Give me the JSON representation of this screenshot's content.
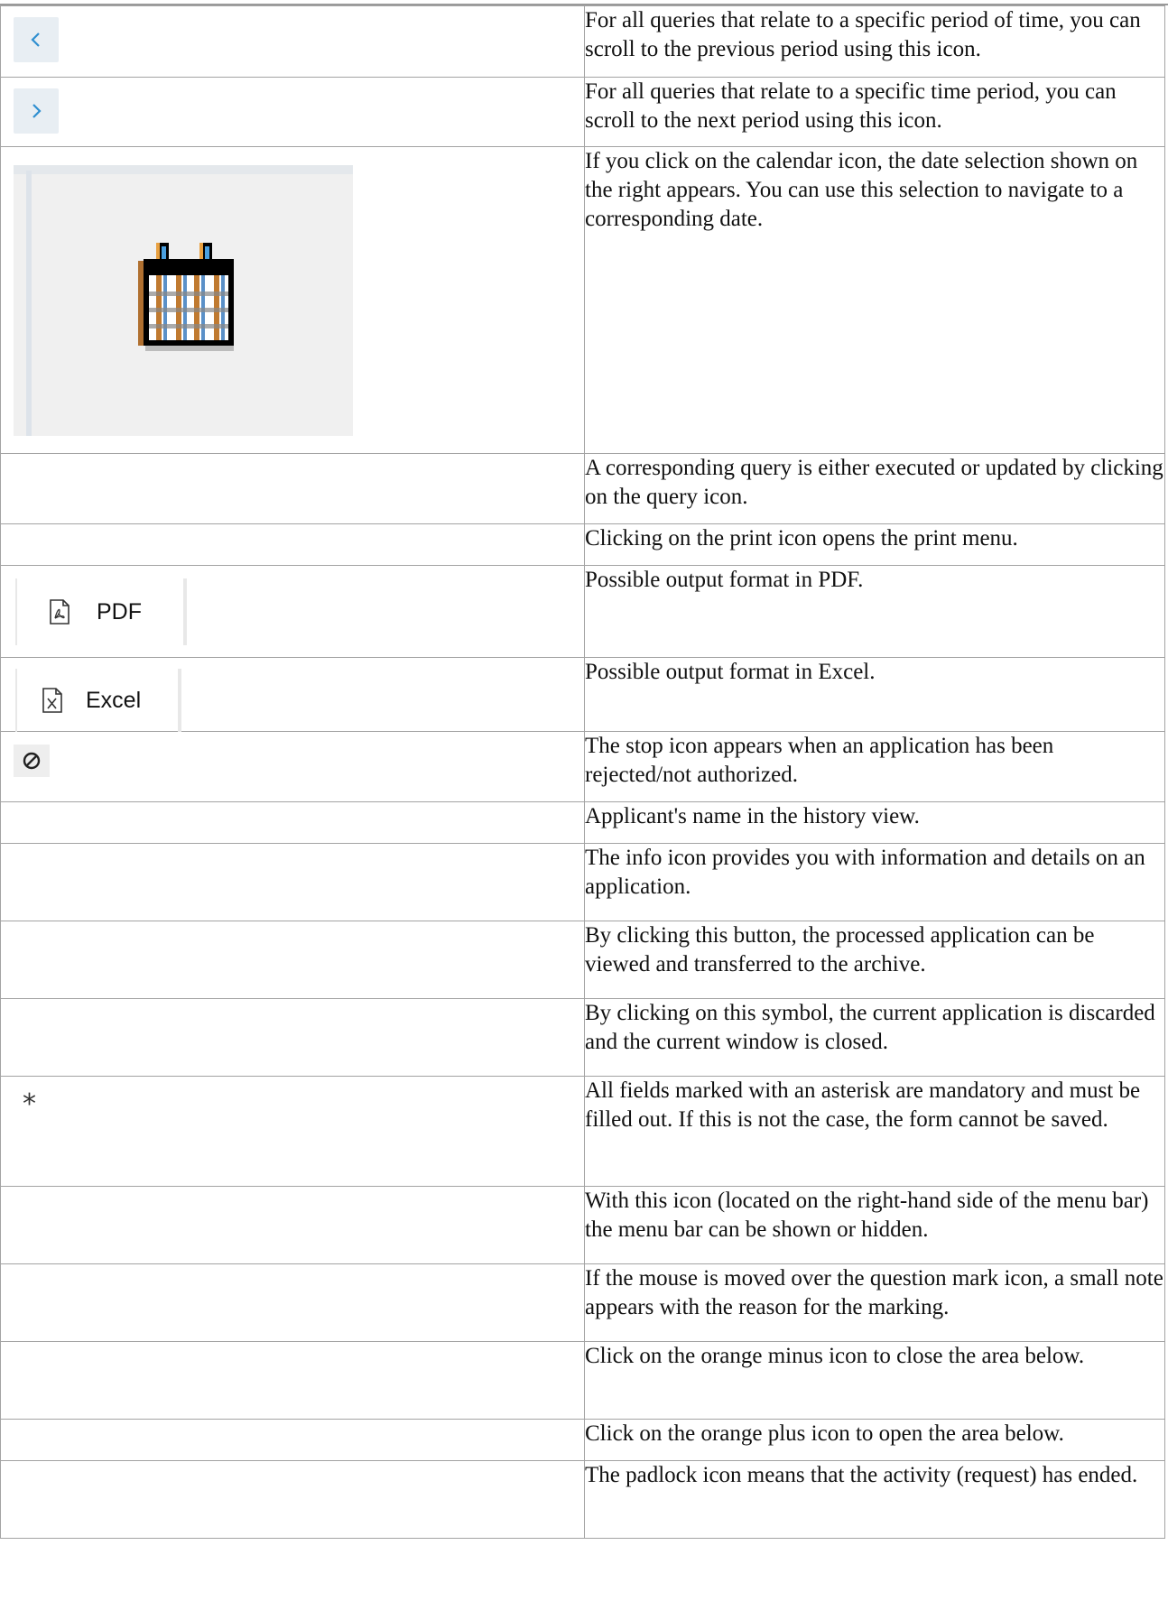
{
  "rows": [
    {
      "icon": "chevron-left-icon",
      "text": "For all queries that relate to a specific period of time, you can scroll to the previous period using this icon."
    },
    {
      "icon": "chevron-right-icon",
      "text": "For all queries that relate to a specific time period, you can scroll to the next period using this icon."
    },
    {
      "icon": "calendar-icon",
      "text": "If you click on the calendar icon, the date selection shown on the right appears. You can use this selection to navigate to a corresponding date."
    },
    {
      "icon": "",
      "text": "A corresponding query is either executed or updated by clicking on the query icon."
    },
    {
      "icon": "",
      "text": "Clicking on the print icon opens the print menu."
    },
    {
      "icon": "pdf-file-icon",
      "button_label": "PDF",
      "text": "Possible output format in PDF."
    },
    {
      "icon": "excel-file-icon",
      "button_label": "Excel",
      "text": "Possible output format in Excel."
    },
    {
      "icon": "stop-icon",
      "text": "The stop icon appears when an application has been rejected/not authorized."
    },
    {
      "icon": "",
      "text": "Applicant's name in the history view."
    },
    {
      "icon": "",
      "text": "The info icon provides you with information and details on an application."
    },
    {
      "icon": "",
      "text": "By clicking this button, the processed application can be viewed and transferred to the archive."
    },
    {
      "icon": "",
      "text": "By clicking on this symbol, the current application is discarded and the current window is closed."
    },
    {
      "icon": "asterisk-icon",
      "symbol": "*",
      "text": "All fields marked with an asterisk are mandatory and must be filled out. If this is not the case, the form cannot be saved."
    },
    {
      "icon": "",
      "text": "With this icon (located on the right-hand side of the menu bar) the menu bar can be shown or hidden."
    },
    {
      "icon": "",
      "text": "If the mouse is moved over the question mark icon, a small note appears with the reason for the marking."
    },
    {
      "icon": "",
      "text": "Click on the orange minus icon to close the area below."
    },
    {
      "icon": "",
      "text": "Click on the orange plus icon to open the area below."
    },
    {
      "icon": "",
      "text": "The padlock icon means that the activity (request) has ended."
    }
  ],
  "colors": {
    "chevron": "#2f8fd0",
    "border": "#a3a3a3",
    "icon_button_bg": "#e8eef3"
  }
}
